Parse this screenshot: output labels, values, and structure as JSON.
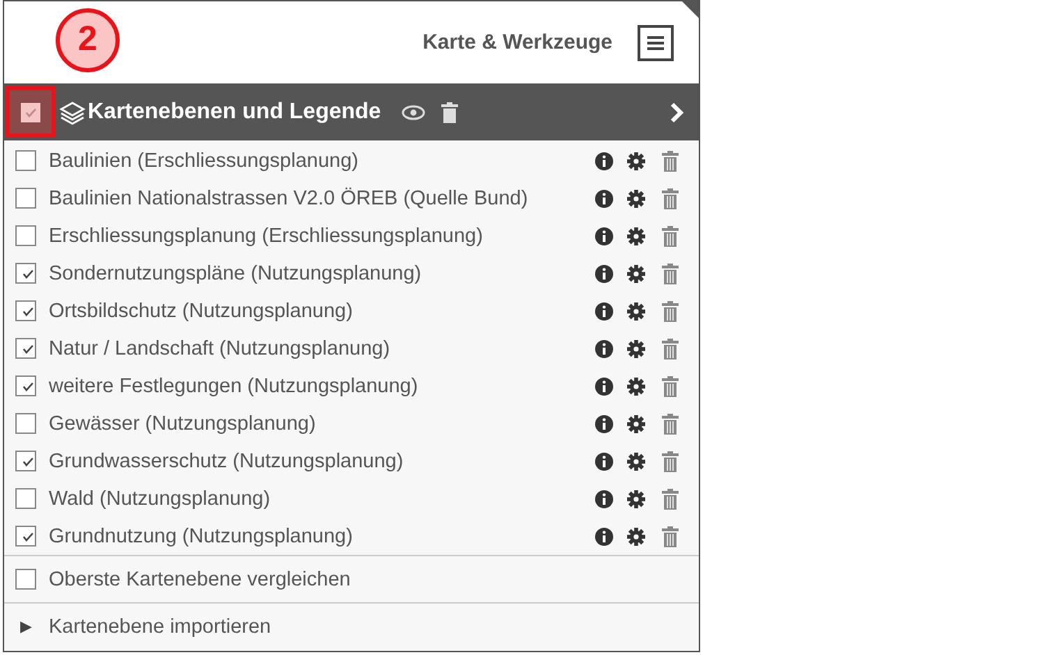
{
  "callout": {
    "number": "2"
  },
  "header": {
    "title": "Karte & Werkzeuge"
  },
  "layer_bar": {
    "title": "Kartenebenen und Legende",
    "checked": true,
    "highlighted": true
  },
  "layers": [
    {
      "name": "Baulinien (Erschliessungsplanung)",
      "checked": false
    },
    {
      "name": "Baulinien Nationalstrassen V2.0 ÖREB (Quelle Bund)",
      "checked": false
    },
    {
      "name": "Erschliessungsplanung (Erschliessungsplanung)",
      "checked": false
    },
    {
      "name": "Sondernutzungspläne (Nutzungsplanung)",
      "checked": true
    },
    {
      "name": "Ortsbildschutz (Nutzungsplanung)",
      "checked": true
    },
    {
      "name": "Natur / Landschaft (Nutzungsplanung)",
      "checked": true
    },
    {
      "name": "weitere Festlegungen (Nutzungsplanung)",
      "checked": true
    },
    {
      "name": "Gewässer (Nutzungsplanung)",
      "checked": false
    },
    {
      "name": "Grundwasserschutz (Nutzungsplanung)",
      "checked": true
    },
    {
      "name": "Wald (Nutzungsplanung)",
      "checked": false
    },
    {
      "name": "Grundnutzung (Nutzungsplanung)",
      "checked": true
    }
  ],
  "compare": {
    "label": "Oberste Kartenebene vergleichen",
    "checked": false
  },
  "import": {
    "arrow": "▶",
    "label": "Kartenebene importieren"
  }
}
